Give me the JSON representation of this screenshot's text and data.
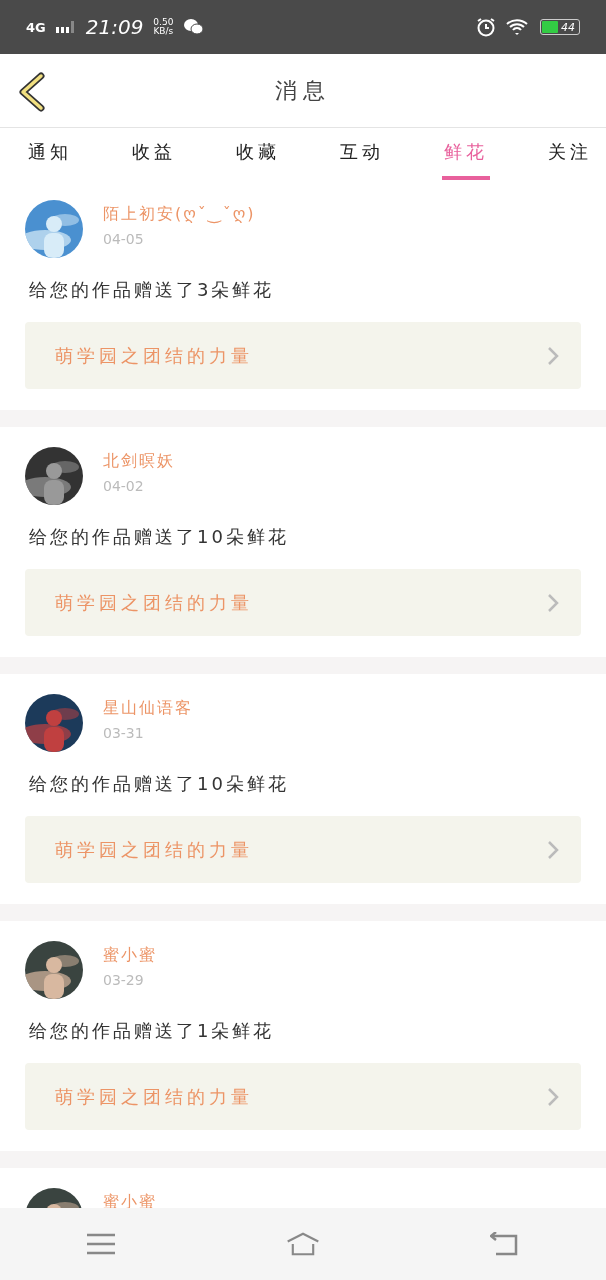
{
  "status_bar": {
    "network": "4G",
    "time": "21:09",
    "speed": "0.50",
    "speed_unit": "KB/s",
    "battery": "44"
  },
  "header": {
    "title": "消息"
  },
  "tabs": [
    {
      "label": "通知",
      "selected": false
    },
    {
      "label": "收益",
      "selected": false
    },
    {
      "label": "收藏",
      "selected": false
    },
    {
      "label": "互动",
      "selected": false
    },
    {
      "label": "鲜花",
      "selected": true
    },
    {
      "label": "关注",
      "selected": false
    }
  ],
  "messages": [
    {
      "name": "陌上初安(ღˇ‿ˇღ)",
      "date": "04-05",
      "text": "给您的作品赠送了3朵鲜花",
      "work": "萌学园之团结的力量"
    },
    {
      "name": "北剑暝妖",
      "date": "04-02",
      "text": "给您的作品赠送了10朵鲜花",
      "work": "萌学园之团结的力量"
    },
    {
      "name": "星山仙语客",
      "date": "03-31",
      "text": "给您的作品赠送了10朵鲜花",
      "work": "萌学园之团结的力量"
    },
    {
      "name": "蜜小蜜",
      "date": "03-29",
      "text": "给您的作品赠送了1朵鲜花",
      "work": "萌学园之团结的力量"
    },
    {
      "name": "蜜小蜜"
    }
  ]
}
